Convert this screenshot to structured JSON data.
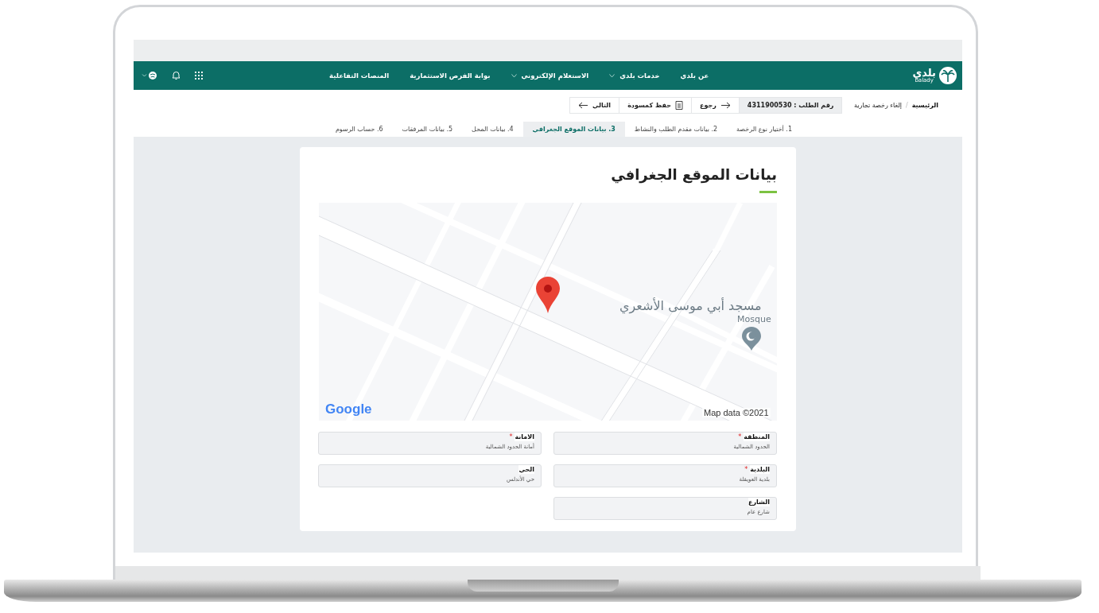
{
  "logo": {
    "arabic": "بلدي",
    "latin": "balady"
  },
  "nav": [
    {
      "label": "عن بلدي",
      "dropdown": false
    },
    {
      "label": "خدمات بلدي",
      "dropdown": true
    },
    {
      "label": "الاستعلام الإلكتروني",
      "dropdown": true
    },
    {
      "label": "بوابة الفرص الاستثمارية",
      "dropdown": false
    },
    {
      "label": "المنصات التفاعلية",
      "dropdown": false
    }
  ],
  "breadcrumb": [
    "الرئيسية",
    "إلغاء رخصة تجارية"
  ],
  "breadcrumb_separator": "/",
  "request_number": "رقم الطلب : 4311900530",
  "actions": [
    {
      "kind": "back",
      "label": "رجوع"
    },
    {
      "kind": "save",
      "label": "حفظ كمسودة"
    },
    {
      "kind": "next",
      "label": "التالي"
    }
  ],
  "steps": [
    {
      "number": "1.",
      "label": "أختيار نوع الرخصة",
      "selected": false
    },
    {
      "number": "2.",
      "label": "بيانات مقدم الطلب والنشاط",
      "selected": false
    },
    {
      "number": "3.",
      "label": "بيانات الموقع الجغرافي",
      "selected": true
    },
    {
      "number": "4.",
      "label": "بيانات المحل",
      "selected": false
    },
    {
      "number": "5.",
      "label": "بيانات المرفقات",
      "selected": false
    },
    {
      "number": "6.",
      "label": "حساب الرسوم",
      "selected": false
    }
  ],
  "section_title": "بيانات الموقع الجغرافي",
  "required_mark": "*",
  "map": {
    "poi_name": "مسجد أبي موسى الأشعري",
    "poi_type": "Mosque",
    "brand": "Google",
    "attribution": "Map data ©2021"
  },
  "fields": [
    {
      "label": "المنطقة",
      "required": true,
      "value": "الحدود الشمالية"
    },
    {
      "label": "الامانة",
      "required": true,
      "value": "أمانة الحدود الشمالية"
    },
    {
      "label": "البلدية",
      "required": true,
      "value": "بلدية العويقلة"
    },
    {
      "label": "الحي",
      "required": false,
      "value": "حي الأندلس"
    },
    {
      "label": "الشارع",
      "required": false,
      "value": "شارع عام"
    }
  ]
}
